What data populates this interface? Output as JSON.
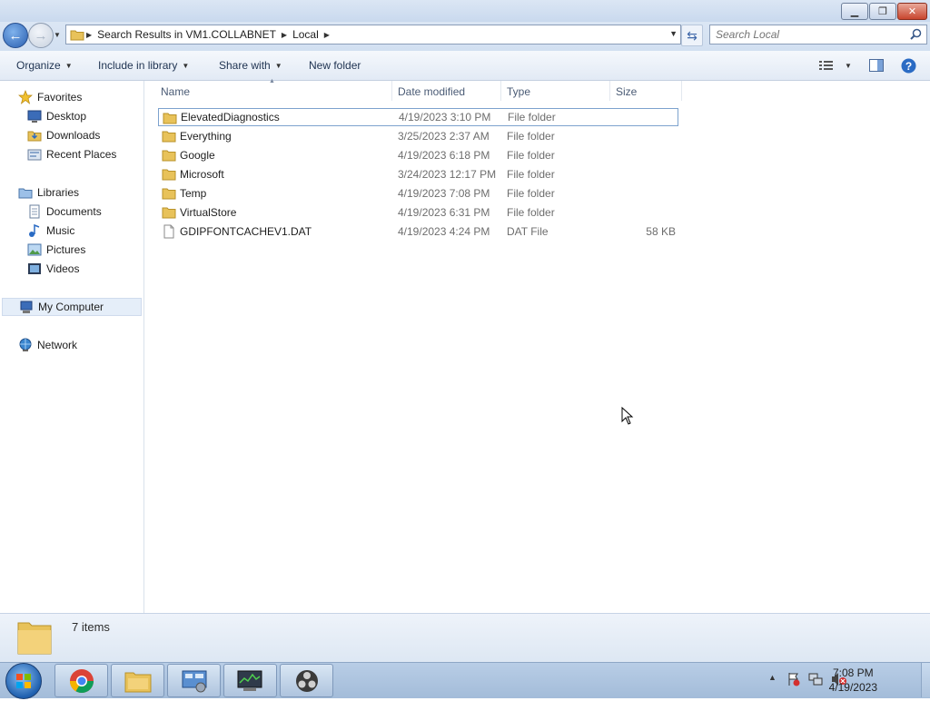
{
  "window": {
    "minimize_label": "▁",
    "restore_label": "❐",
    "close_label": "✕"
  },
  "address": {
    "crumbs": [
      "Search Results in VM1.COLLABNET",
      "Local"
    ]
  },
  "search": {
    "placeholder": "Search Local"
  },
  "toolbar": {
    "organize": "Organize",
    "include_in_library": "Include in library",
    "share_with": "Share with",
    "new_folder": "New folder"
  },
  "nav": {
    "favorites": "Favorites",
    "desktop": "Desktop",
    "downloads": "Downloads",
    "recent_places": "Recent Places",
    "libraries": "Libraries",
    "documents": "Documents",
    "music": "Music",
    "pictures": "Pictures",
    "videos": "Videos",
    "my_computer": "My Computer",
    "network": "Network"
  },
  "columns": {
    "name": "Name",
    "date_modified": "Date modified",
    "type": "Type",
    "size": "Size"
  },
  "files": [
    {
      "name": "ElevatedDiagnostics",
      "date": "4/19/2023 3:10 PM",
      "type": "File folder",
      "size": "",
      "icon": "folder-icon"
    },
    {
      "name": "Everything",
      "date": "3/25/2023 2:37 AM",
      "type": "File folder",
      "size": "",
      "icon": "folder-icon"
    },
    {
      "name": "Google",
      "date": "4/19/2023 6:18 PM",
      "type": "File folder",
      "size": "",
      "icon": "folder-icon"
    },
    {
      "name": "Microsoft",
      "date": "3/24/2023 12:17 PM",
      "type": "File folder",
      "size": "",
      "icon": "folder-icon"
    },
    {
      "name": "Temp",
      "date": "4/19/2023 7:08 PM",
      "type": "File folder",
      "size": "",
      "icon": "folder-icon"
    },
    {
      "name": "VirtualStore",
      "date": "4/19/2023 6:31 PM",
      "type": "File folder",
      "size": "",
      "icon": "folder-icon"
    },
    {
      "name": "GDIPFONTCACHEV1.DAT",
      "date": "4/19/2023 4:24 PM",
      "type": "DAT File",
      "size": "58 KB",
      "icon": "file-icon"
    }
  ],
  "status": {
    "item_count": "7 items"
  },
  "taskbar": {
    "time": "7:08 PM",
    "date": "4/19/2023"
  },
  "colors": {
    "folder": "#e8c25a",
    "selection_border": "#7da2ce",
    "title_gradient_top": "#dbe6f4"
  }
}
